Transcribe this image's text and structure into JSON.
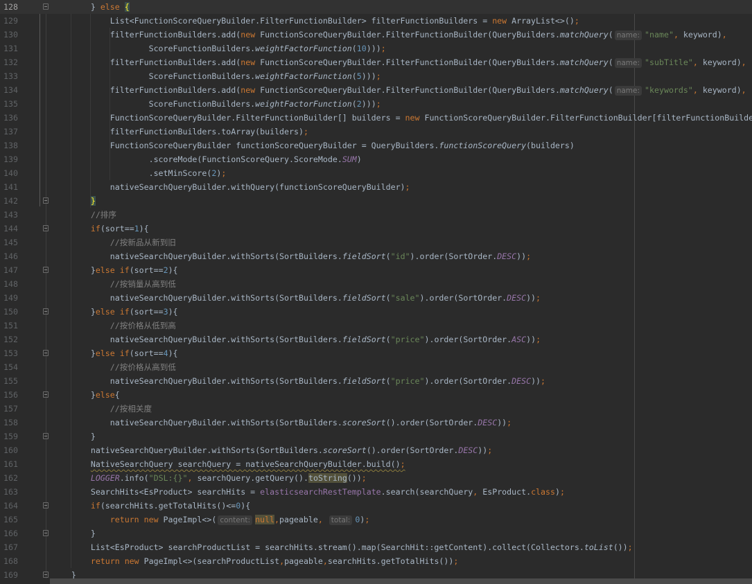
{
  "editor": {
    "current_line": 128,
    "fold_lines": [
      128,
      142,
      144,
      147,
      150,
      153,
      156,
      159,
      164,
      166,
      169
    ],
    "lines": [
      {
        "n": "128",
        "t": [
          [
            "d",
            "        } "
          ],
          [
            "k",
            "else "
          ],
          [
            "b",
            "{"
          ]
        ]
      },
      {
        "n": "129",
        "t": [
          [
            "d",
            "            List<FunctionScoreQueryBuilder.FilterFunctionBuilder> filterFunctionBuilders = "
          ],
          [
            "k",
            "new "
          ],
          [
            "d",
            "ArrayList<>()"
          ],
          [
            "k",
            ";"
          ]
        ]
      },
      {
        "n": "130",
        "t": [
          [
            "d",
            "            filterFunctionBuilders.add("
          ],
          [
            "k",
            "new "
          ],
          [
            "d",
            "FunctionScoreQueryBuilder.FilterFunctionBuilder(QueryBuilders."
          ],
          [
            "i",
            "matchQuery"
          ],
          [
            "d",
            "("
          ],
          [
            "h",
            "name:"
          ],
          [
            "s",
            "\"name\""
          ],
          [
            "k",
            ", "
          ],
          [
            "d",
            "keyword)"
          ],
          [
            "k",
            ","
          ]
        ]
      },
      {
        "n": "131",
        "t": [
          [
            "d",
            "                    ScoreFunctionBuilders."
          ],
          [
            "i",
            "weightFactorFunction"
          ],
          [
            "d",
            "("
          ],
          [
            "n",
            "10"
          ],
          [
            "d",
            ")))"
          ],
          [
            "k",
            ";"
          ]
        ]
      },
      {
        "n": "132",
        "t": [
          [
            "d",
            "            filterFunctionBuilders.add("
          ],
          [
            "k",
            "new "
          ],
          [
            "d",
            "FunctionScoreQueryBuilder.FilterFunctionBuilder(QueryBuilders."
          ],
          [
            "i",
            "matchQuery"
          ],
          [
            "d",
            "("
          ],
          [
            "h",
            "name:"
          ],
          [
            "s",
            "\"subTitle\""
          ],
          [
            "k",
            ", "
          ],
          [
            "d",
            "keyword)"
          ],
          [
            "k",
            ","
          ]
        ]
      },
      {
        "n": "133",
        "t": [
          [
            "d",
            "                    ScoreFunctionBuilders."
          ],
          [
            "i",
            "weightFactorFunction"
          ],
          [
            "d",
            "("
          ],
          [
            "n",
            "5"
          ],
          [
            "d",
            ")))"
          ],
          [
            "k",
            ";"
          ]
        ]
      },
      {
        "n": "134",
        "t": [
          [
            "d",
            "            filterFunctionBuilders.add("
          ],
          [
            "k",
            "new "
          ],
          [
            "d",
            "FunctionScoreQueryBuilder.FilterFunctionBuilder(QueryBuilders."
          ],
          [
            "i",
            "matchQuery"
          ],
          [
            "d",
            "("
          ],
          [
            "h",
            "name:"
          ],
          [
            "s",
            "\"keywords\""
          ],
          [
            "k",
            ", "
          ],
          [
            "d",
            "keyword)"
          ],
          [
            "k",
            ","
          ]
        ]
      },
      {
        "n": "135",
        "t": [
          [
            "d",
            "                    ScoreFunctionBuilders."
          ],
          [
            "i",
            "weightFactorFunction"
          ],
          [
            "d",
            "("
          ],
          [
            "n",
            "2"
          ],
          [
            "d",
            ")))"
          ],
          [
            "k",
            ";"
          ]
        ]
      },
      {
        "n": "136",
        "t": [
          [
            "d",
            "            FunctionScoreQueryBuilder.FilterFunctionBuilder[] builders = "
          ],
          [
            "k",
            "new "
          ],
          [
            "d",
            "FunctionScoreQueryBuilder.FilterFunctionBuilder[filterFunctionBuilde"
          ]
        ]
      },
      {
        "n": "137",
        "t": [
          [
            "d",
            "            filterFunctionBuilders.toArray(builders)"
          ],
          [
            "k",
            ";"
          ]
        ]
      },
      {
        "n": "138",
        "t": [
          [
            "d",
            "            FunctionScoreQueryBuilder functionScoreQueryBuilder = QueryBuilders."
          ],
          [
            "i",
            "functionScoreQuery"
          ],
          [
            "d",
            "(builders)"
          ]
        ]
      },
      {
        "n": "139",
        "t": [
          [
            "d",
            "                    .scoreMode(FunctionScoreQuery.ScoreMode."
          ],
          [
            "c",
            "SUM"
          ],
          [
            "d",
            ")"
          ]
        ]
      },
      {
        "n": "140",
        "t": [
          [
            "d",
            "                    .setMinScore("
          ],
          [
            "n",
            "2"
          ],
          [
            "d",
            ")"
          ],
          [
            "k",
            ";"
          ]
        ]
      },
      {
        "n": "141",
        "t": [
          [
            "d",
            "            nativeSearchQueryBuilder.withQuery(functionScoreQueryBuilder)"
          ],
          [
            "k",
            ";"
          ]
        ]
      },
      {
        "n": "142",
        "t": [
          [
            "d",
            "        "
          ],
          [
            "b",
            "}"
          ]
        ]
      },
      {
        "n": "143",
        "t": [
          [
            "d",
            "        "
          ],
          [
            "cm",
            "//排序"
          ]
        ]
      },
      {
        "n": "144",
        "t": [
          [
            "d",
            "        "
          ],
          [
            "k",
            "if"
          ],
          [
            "d",
            "(sort=="
          ],
          [
            "n",
            "1"
          ],
          [
            "d",
            "){"
          ]
        ]
      },
      {
        "n": "145",
        "t": [
          [
            "d",
            "            "
          ],
          [
            "cm",
            "//按新品从新到旧"
          ]
        ]
      },
      {
        "n": "146",
        "t": [
          [
            "d",
            "            nativeSearchQueryBuilder.withSorts(SortBuilders."
          ],
          [
            "i",
            "fieldSort"
          ],
          [
            "d",
            "("
          ],
          [
            "s",
            "\"id\""
          ],
          [
            "d",
            ").order(SortOrder."
          ],
          [
            "c",
            "DESC"
          ],
          [
            "d",
            "))"
          ],
          [
            "k",
            ";"
          ]
        ]
      },
      {
        "n": "147",
        "t": [
          [
            "d",
            "        }"
          ],
          [
            "k",
            "else if"
          ],
          [
            "d",
            "(sort=="
          ],
          [
            "n",
            "2"
          ],
          [
            "d",
            "){"
          ]
        ]
      },
      {
        "n": "148",
        "t": [
          [
            "d",
            "            "
          ],
          [
            "cm",
            "//按销量从高到低"
          ]
        ]
      },
      {
        "n": "149",
        "t": [
          [
            "d",
            "            nativeSearchQueryBuilder.withSorts(SortBuilders."
          ],
          [
            "i",
            "fieldSort"
          ],
          [
            "d",
            "("
          ],
          [
            "s",
            "\"sale\""
          ],
          [
            "d",
            ").order(SortOrder."
          ],
          [
            "c",
            "DESC"
          ],
          [
            "d",
            "))"
          ],
          [
            "k",
            ";"
          ]
        ]
      },
      {
        "n": "150",
        "t": [
          [
            "d",
            "        }"
          ],
          [
            "k",
            "else if"
          ],
          [
            "d",
            "(sort=="
          ],
          [
            "n",
            "3"
          ],
          [
            "d",
            "){"
          ]
        ]
      },
      {
        "n": "151",
        "t": [
          [
            "d",
            "            "
          ],
          [
            "cm",
            "//按价格从低到高"
          ]
        ]
      },
      {
        "n": "152",
        "t": [
          [
            "d",
            "            nativeSearchQueryBuilder.withSorts(SortBuilders."
          ],
          [
            "i",
            "fieldSort"
          ],
          [
            "d",
            "("
          ],
          [
            "s",
            "\"price\""
          ],
          [
            "d",
            ").order(SortOrder."
          ],
          [
            "c",
            "ASC"
          ],
          [
            "d",
            "))"
          ],
          [
            "k",
            ";"
          ]
        ]
      },
      {
        "n": "153",
        "t": [
          [
            "d",
            "        }"
          ],
          [
            "k",
            "else if"
          ],
          [
            "d",
            "(sort=="
          ],
          [
            "n",
            "4"
          ],
          [
            "d",
            "){"
          ]
        ]
      },
      {
        "n": "154",
        "t": [
          [
            "d",
            "            "
          ],
          [
            "cm",
            "//按价格从高到低"
          ]
        ]
      },
      {
        "n": "155",
        "t": [
          [
            "d",
            "            nativeSearchQueryBuilder.withSorts(SortBuilders."
          ],
          [
            "i",
            "fieldSort"
          ],
          [
            "d",
            "("
          ],
          [
            "s",
            "\"price\""
          ],
          [
            "d",
            ").order(SortOrder."
          ],
          [
            "c",
            "DESC"
          ],
          [
            "d",
            "))"
          ],
          [
            "k",
            ";"
          ]
        ]
      },
      {
        "n": "156",
        "t": [
          [
            "d",
            "        }"
          ],
          [
            "k",
            "else"
          ],
          [
            "d",
            "{"
          ]
        ]
      },
      {
        "n": "157",
        "t": [
          [
            "d",
            "            "
          ],
          [
            "cm",
            "//按相关度"
          ]
        ]
      },
      {
        "n": "158",
        "t": [
          [
            "d",
            "            nativeSearchQueryBuilder.withSorts(SortBuilders."
          ],
          [
            "i",
            "scoreSort"
          ],
          [
            "d",
            "().order(SortOrder."
          ],
          [
            "c",
            "DESC"
          ],
          [
            "d",
            "))"
          ],
          [
            "k",
            ";"
          ]
        ]
      },
      {
        "n": "159",
        "t": [
          [
            "d",
            "        }"
          ]
        ]
      },
      {
        "n": "160",
        "t": [
          [
            "d",
            "        nativeSearchQueryBuilder.withSorts(SortBuilders."
          ],
          [
            "i",
            "scoreSort"
          ],
          [
            "d",
            "().order(SortOrder."
          ],
          [
            "c",
            "DESC"
          ],
          [
            "d",
            "))"
          ],
          [
            "k",
            ";"
          ]
        ]
      },
      {
        "n": "161",
        "t": [
          [
            "d",
            "        "
          ],
          [
            "w",
            "NativeSearchQuery searchQuery = nativeSearchQueryBuilder.build()"
          ],
          [
            "wk",
            ";"
          ]
        ]
      },
      {
        "n": "162",
        "t": [
          [
            "d",
            "        "
          ],
          [
            "c",
            "LOGGER"
          ],
          [
            "d",
            ".info("
          ],
          [
            "s",
            "\"DSL:{}\""
          ],
          [
            "k",
            ", "
          ],
          [
            "d",
            "searchQuery.getQuery()."
          ],
          [
            "hl",
            "toString"
          ],
          [
            "d",
            "())"
          ],
          [
            "k",
            ";"
          ]
        ]
      },
      {
        "n": "163",
        "t": [
          [
            "d",
            "        SearchHits<EsProduct> searchHits = "
          ],
          [
            "f",
            "elasticsearchRestTemplate"
          ],
          [
            "d",
            ".search(searchQuery"
          ],
          [
            "k",
            ", "
          ],
          [
            "d",
            "EsProduct."
          ],
          [
            "k",
            "class"
          ],
          [
            "d",
            ")"
          ],
          [
            "k",
            ";"
          ]
        ]
      },
      {
        "n": "164",
        "t": [
          [
            "d",
            "        "
          ],
          [
            "k",
            "if"
          ],
          [
            "d",
            "(searchHits.getTotalHits()<="
          ],
          [
            "n",
            "0"
          ],
          [
            "d",
            "){"
          ]
        ]
      },
      {
        "n": "165",
        "t": [
          [
            "d",
            "            "
          ],
          [
            "k",
            "return new "
          ],
          [
            "d",
            "PageImpl<>("
          ],
          [
            "h",
            "content:"
          ],
          [
            "khl",
            "null"
          ],
          [
            "k",
            ","
          ],
          [
            "d",
            "pageable"
          ],
          [
            "k",
            ", "
          ],
          [
            "h",
            "total:"
          ],
          [
            "n",
            "0"
          ],
          [
            "d",
            ")"
          ],
          [
            "k",
            ";"
          ]
        ]
      },
      {
        "n": "166",
        "t": [
          [
            "d",
            "        }"
          ]
        ]
      },
      {
        "n": "167",
        "t": [
          [
            "d",
            "        List<EsProduct> searchProductList = searchHits.stream().map(SearchHit::getContent).collect(Collectors."
          ],
          [
            "i",
            "toList"
          ],
          [
            "d",
            "())"
          ],
          [
            "k",
            ";"
          ]
        ]
      },
      {
        "n": "168",
        "t": [
          [
            "d",
            "        "
          ],
          [
            "k",
            "return new "
          ],
          [
            "d",
            "PageImpl<>(searchProductList"
          ],
          [
            "k",
            ","
          ],
          [
            "d",
            "pageable"
          ],
          [
            "k",
            ","
          ],
          [
            "d",
            "searchHits.getTotalHits())"
          ],
          [
            "k",
            ";"
          ]
        ]
      },
      {
        "n": "169",
        "t": [
          [
            "d",
            "    }"
          ]
        ]
      }
    ]
  }
}
